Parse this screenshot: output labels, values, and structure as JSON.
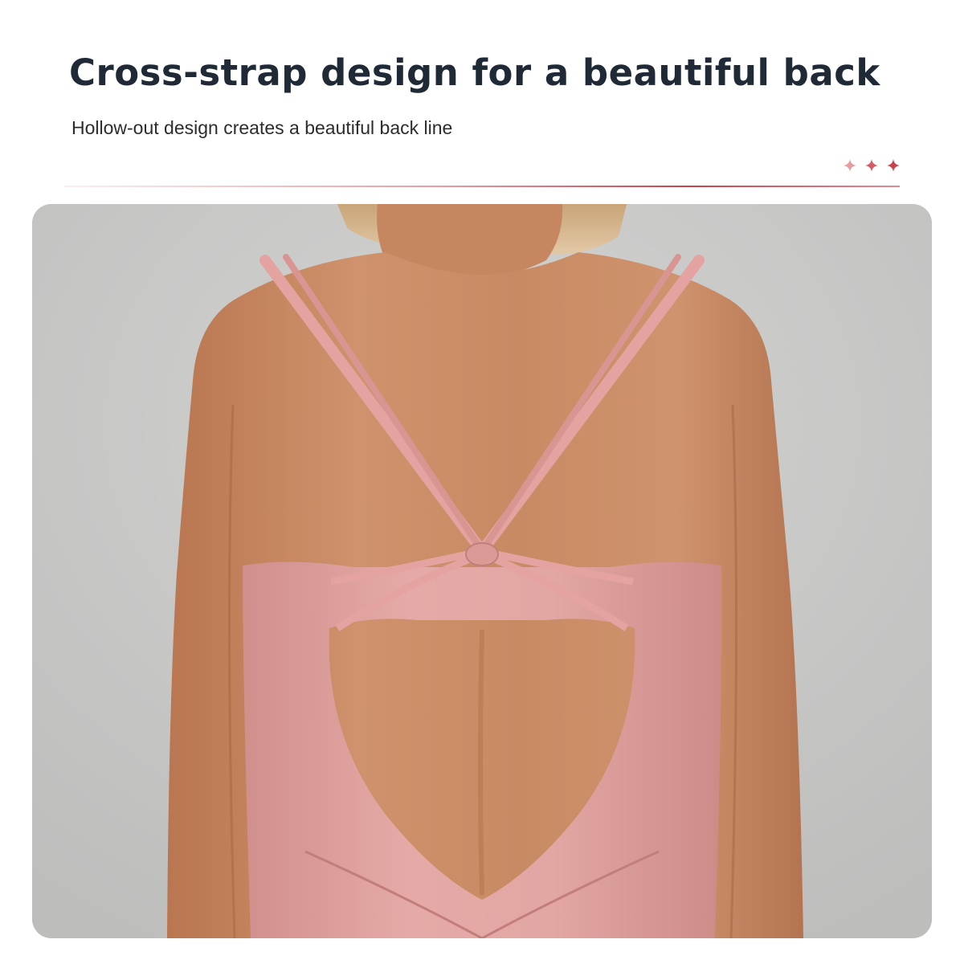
{
  "header": {
    "title": "Cross-strap design for a beautiful back",
    "subtitle": "Hollow-out design creates a beautiful back line",
    "sparkle_icon": "sparkle-icon",
    "accent_color": "#c9434d"
  },
  "photo": {
    "subject": "back-view-cross-strap-jumpsuit",
    "background_color": "#c9c9c8",
    "garment_color": "#e0a4a1",
    "skin_color": "#c98a64"
  }
}
